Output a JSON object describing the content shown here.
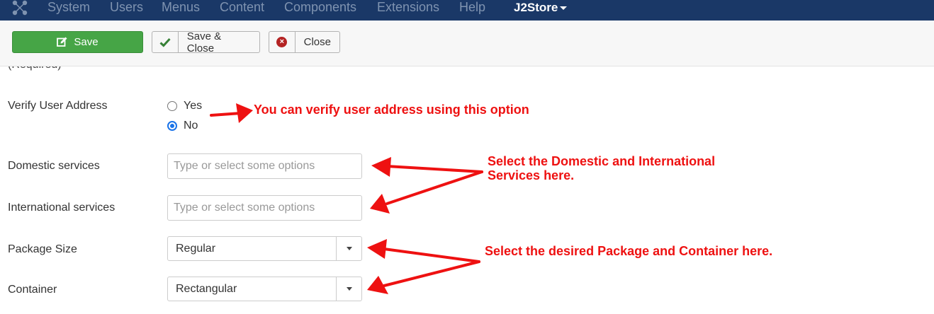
{
  "navbar": {
    "logo_icon": "joomla-logo-icon",
    "items": [
      {
        "label": "System"
      },
      {
        "label": "Users"
      },
      {
        "label": "Menus"
      },
      {
        "label": "Content"
      },
      {
        "label": "Components"
      },
      {
        "label": "Extensions"
      },
      {
        "label": "Help"
      }
    ],
    "active_menu": {
      "label": "J2Store",
      "icon": "caret-down-icon"
    },
    "background_color": "#1a3867"
  },
  "toolbar": {
    "save_label": "Save",
    "save_icon": "edit-icon",
    "save_color": "#46a546",
    "save_close_label": "Save & Close",
    "save_close_icon": "checkmark-icon",
    "close_label": "Close",
    "close_icon": "close-circle-icon"
  },
  "form": {
    "clipped_label": "(Required)",
    "verify_address": {
      "label": "Verify User Address",
      "options": [
        {
          "label": "Yes",
          "checked": false
        },
        {
          "label": "No",
          "checked": true
        }
      ]
    },
    "domestic": {
      "label": "Domestic services",
      "placeholder": "Type or select some options"
    },
    "international": {
      "label": "International services",
      "placeholder": "Type or select some options"
    },
    "package_size": {
      "label": "Package Size",
      "value": "Regular"
    },
    "container": {
      "label": "Container",
      "value": "Rectangular"
    }
  },
  "annotations": {
    "color": "#ee1111",
    "verify": "You can verify user address using this option",
    "services_line1": "Select the Domestic and International",
    "services_line2": "Services here.",
    "package": "Select the desired Package and Container here."
  }
}
